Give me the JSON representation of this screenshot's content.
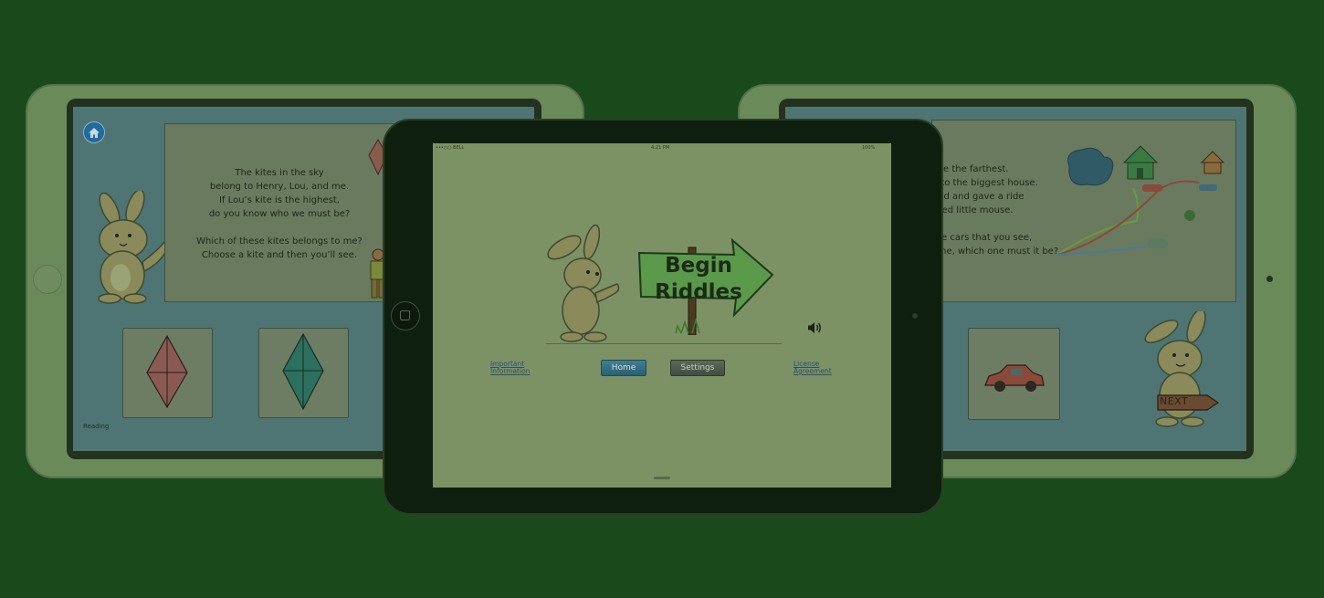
{
  "left_tablet": {
    "poem_lines": [
      "The kites in the sky",
      "belong to Henry, Lou, and me.",
      "If Lou’s kite is the highest,",
      "do you know who we must be?",
      "",
      "Which of these kites belongs to me?",
      "Choose a kite and then you’ll see."
    ],
    "footer_label": "Reading"
  },
  "center_tablet": {
    "status": {
      "carrier": "•••○○ BELL",
      "time": "4:21 PM",
      "battery": "100%"
    },
    "sign_line1": "Begin",
    "sign_line2": "Riddles",
    "buttons": {
      "home": "Home",
      "settings": "Settings"
    },
    "links": {
      "important_line1": "Important",
      "important_line2": "Information",
      "license_line1": "License",
      "license_line2": "Agreement"
    }
  },
  "right_tablet": {
    "poem_lines": [
      "ove the farthest.",
      "e to the biggest house.",
      "ped and gave a ride",
      "tired little mouse.",
      "",
      "ree cars that you see,",
      "nine, which one must it be?"
    ],
    "next_label": "NEXT"
  }
}
